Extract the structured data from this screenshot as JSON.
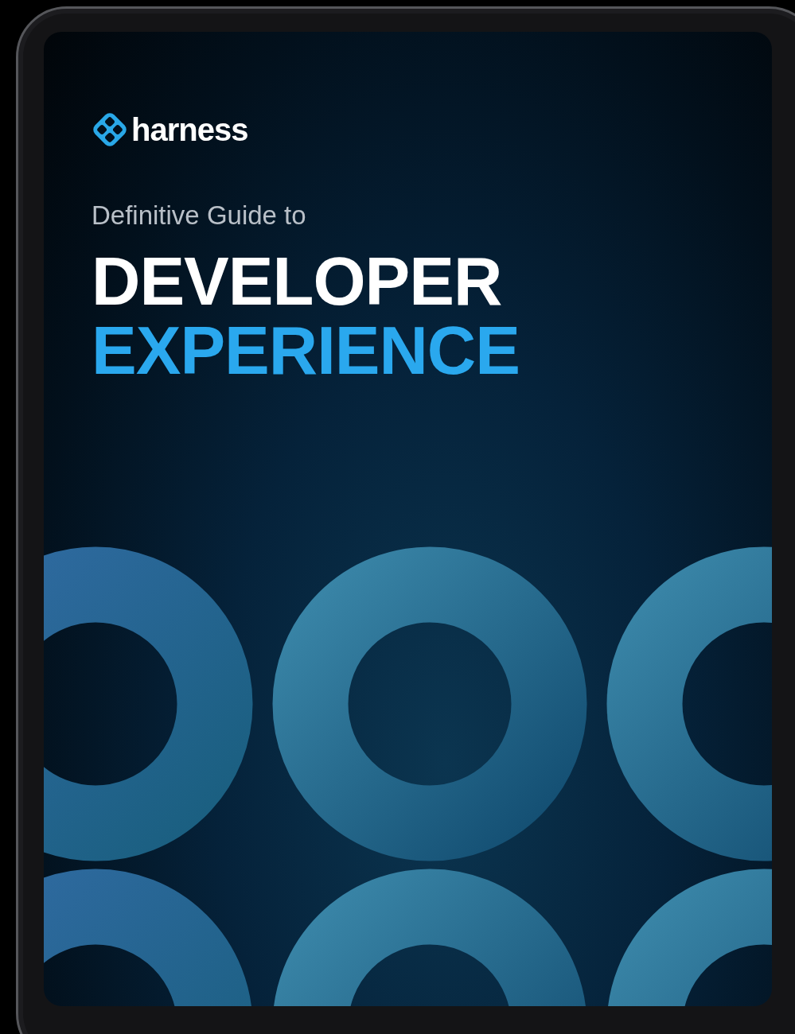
{
  "cover": {
    "logo": "harness",
    "subtitle": "Definitive Guide to",
    "title_lines": [
      {
        "text": "DEVELOPER",
        "color": "#ffffff"
      },
      {
        "text": "EXPERIENCE",
        "color": "#2aa8ee"
      }
    ]
  }
}
